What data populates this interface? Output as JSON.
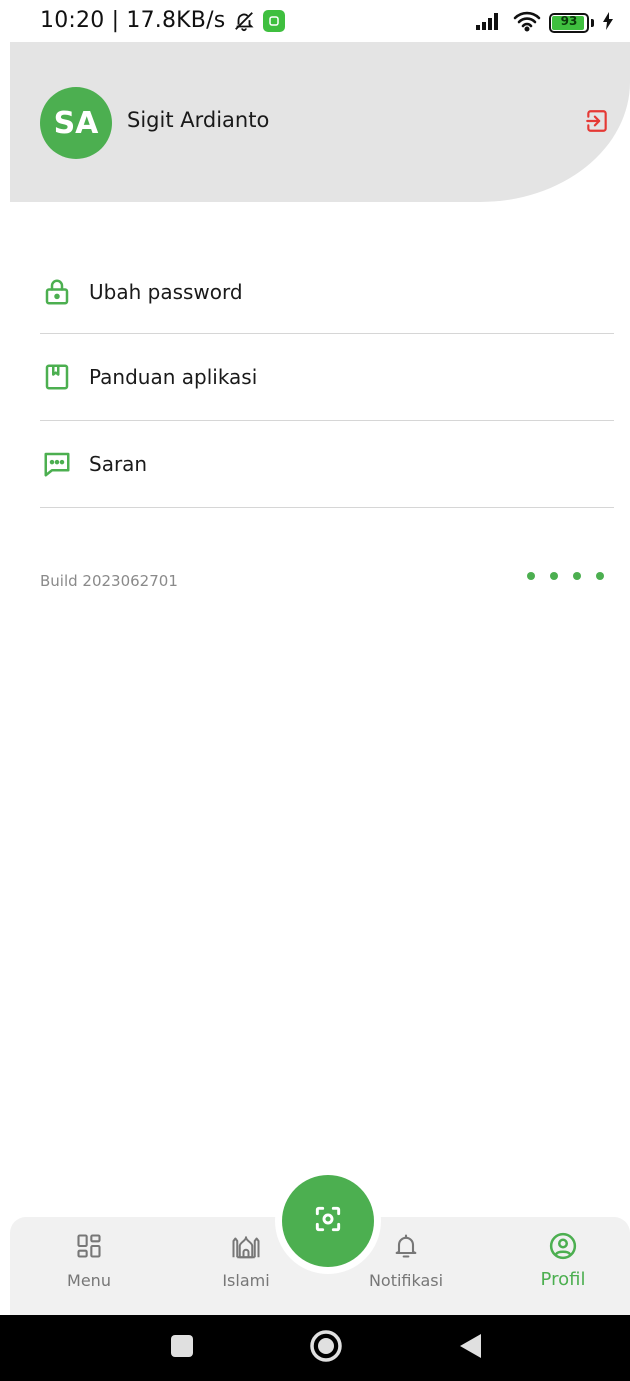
{
  "status_bar": {
    "time_speed": "10:20 | 17.8KB/s",
    "battery_level": "93"
  },
  "profile": {
    "avatar_initials": "SA",
    "user_name": "Sigit Ardianto"
  },
  "menu": {
    "items": [
      {
        "label": "Ubah password",
        "icon": "lock-icon"
      },
      {
        "label": "Panduan aplikasi",
        "icon": "book-icon"
      },
      {
        "label": "Saran",
        "icon": "chat-icon"
      }
    ]
  },
  "build_label": "Build 2023062701",
  "bottom_nav": {
    "items": [
      {
        "label": "Menu",
        "icon": "grid-icon",
        "active": false
      },
      {
        "label": "Islami",
        "icon": "mosque-icon",
        "active": false
      },
      {
        "label": "Notifikasi",
        "icon": "bell-icon",
        "active": false
      },
      {
        "label": "Profil",
        "icon": "user-circle-icon",
        "active": true
      }
    ],
    "center_action_icon": "scan-icon"
  },
  "colors": {
    "accent": "#4caf50",
    "logout": "#e53935",
    "header_bg": "#e4e4e4",
    "inactive": "#777777"
  }
}
